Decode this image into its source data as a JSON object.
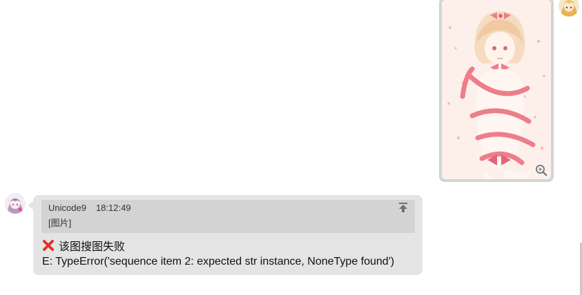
{
  "sent_message": {
    "type": "image",
    "image_description_icon": "anime-illustration"
  },
  "reply": {
    "quote": {
      "sender": "Unicode9",
      "time": "18:12:49",
      "content": "[图片]"
    },
    "status_text": "该图搜图失败",
    "error_text": "E: TypeError('sequence item 2: expected str instance, NoneType found')"
  },
  "colors": {
    "bubble": "#e4e4e4",
    "quote": "#d3d3d3",
    "image_frame": "#d4d4d4",
    "error_icon": "#e0342c"
  },
  "icons": {
    "zoom": "zoom-in-icon",
    "jump": "jump-to-top-icon",
    "fail": "red-cross-icon"
  }
}
